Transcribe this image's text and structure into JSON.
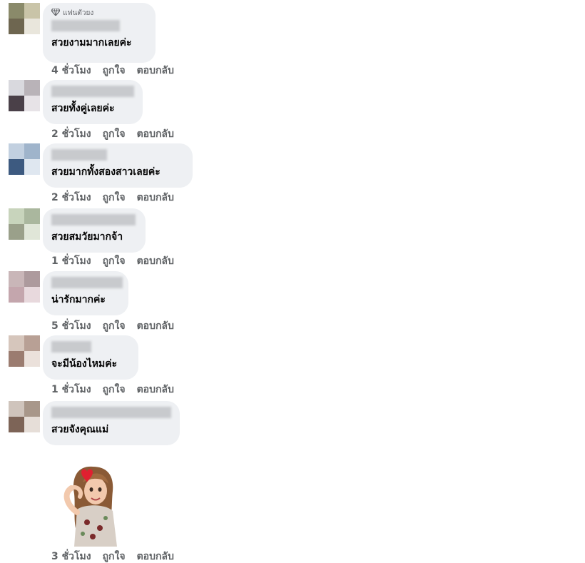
{
  "comments": [
    {
      "badge": "แฟนตัวยง",
      "text": "สวยงามมากเลยค่ะ",
      "time": "4 ชั่วโมง",
      "like": "ถูกใจ",
      "reply": "ตอบกลับ",
      "avatar_colors": [
        "#8a8a6a",
        "#c9c4a8",
        "#6e6650",
        "#e9e6dc"
      ]
    },
    {
      "text": "สวยทั้งคู่เลยค่ะ",
      "time": "2 ชั่วโมง",
      "like": "ถูกใจ",
      "reply": "ตอบกลับ",
      "avatar_colors": [
        "#d9d9de",
        "#b9b3b8",
        "#4a4048",
        "#e7e3e7"
      ]
    },
    {
      "text": "สวยมากทั้งสองสาวเลยค่ะ",
      "time": "2 ชั่วโมง",
      "like": "ถูกใจ",
      "reply": "ตอบกลับ",
      "avatar_colors": [
        "#c2d0e0",
        "#9fb4cb",
        "#3d5a80",
        "#dfe7f0"
      ]
    },
    {
      "text": "สวยสมวัยมากจ้า",
      "time": "1 ชั่วโมง",
      "like": "ถูกใจ",
      "reply": "ตอบกลับ",
      "avatar_colors": [
        "#c8d4bc",
        "#aab79e",
        "#9aa08a",
        "#e0e6d8"
      ]
    },
    {
      "text": "น่ารักมากค่ะ",
      "time": "5 ชั่วโมง",
      "like": "ถูกใจ",
      "reply": "ตอบกลับ",
      "avatar_colors": [
        "#c9b6b8",
        "#ad9a9d",
        "#c4a6ad",
        "#e8d9dd"
      ]
    },
    {
      "text": "จะมีน้องไหมค่ะ",
      "time": "1 ชั่วโมง",
      "like": "ถูกใจ",
      "reply": "ตอบกลับ",
      "avatar_colors": [
        "#d6c6bc",
        "#b8a095",
        "#9b7c70",
        "#ebe1db"
      ]
    },
    {
      "text": "สวยจังคุณแม่",
      "time": "",
      "like": "",
      "reply": "",
      "avatar_colors": [
        "#cfc4bc",
        "#a8978a",
        "#7d6457",
        "#e6ded8"
      ]
    }
  ],
  "action_rows": [
    {
      "time": "1 ชั่วโมง",
      "like": "ถูกใจ",
      "reply": "ตอบกลับ"
    },
    {
      "time": "3 ชั่วโมง",
      "like": "ถูกใจ",
      "reply": "ตอบกลับ"
    }
  ],
  "sticker": {
    "description_icon": "sticker-woman-heart-icon"
  },
  "colors": {
    "bubble": "#eef0f3",
    "action_text": "#606366",
    "comment_text": "#050505"
  }
}
